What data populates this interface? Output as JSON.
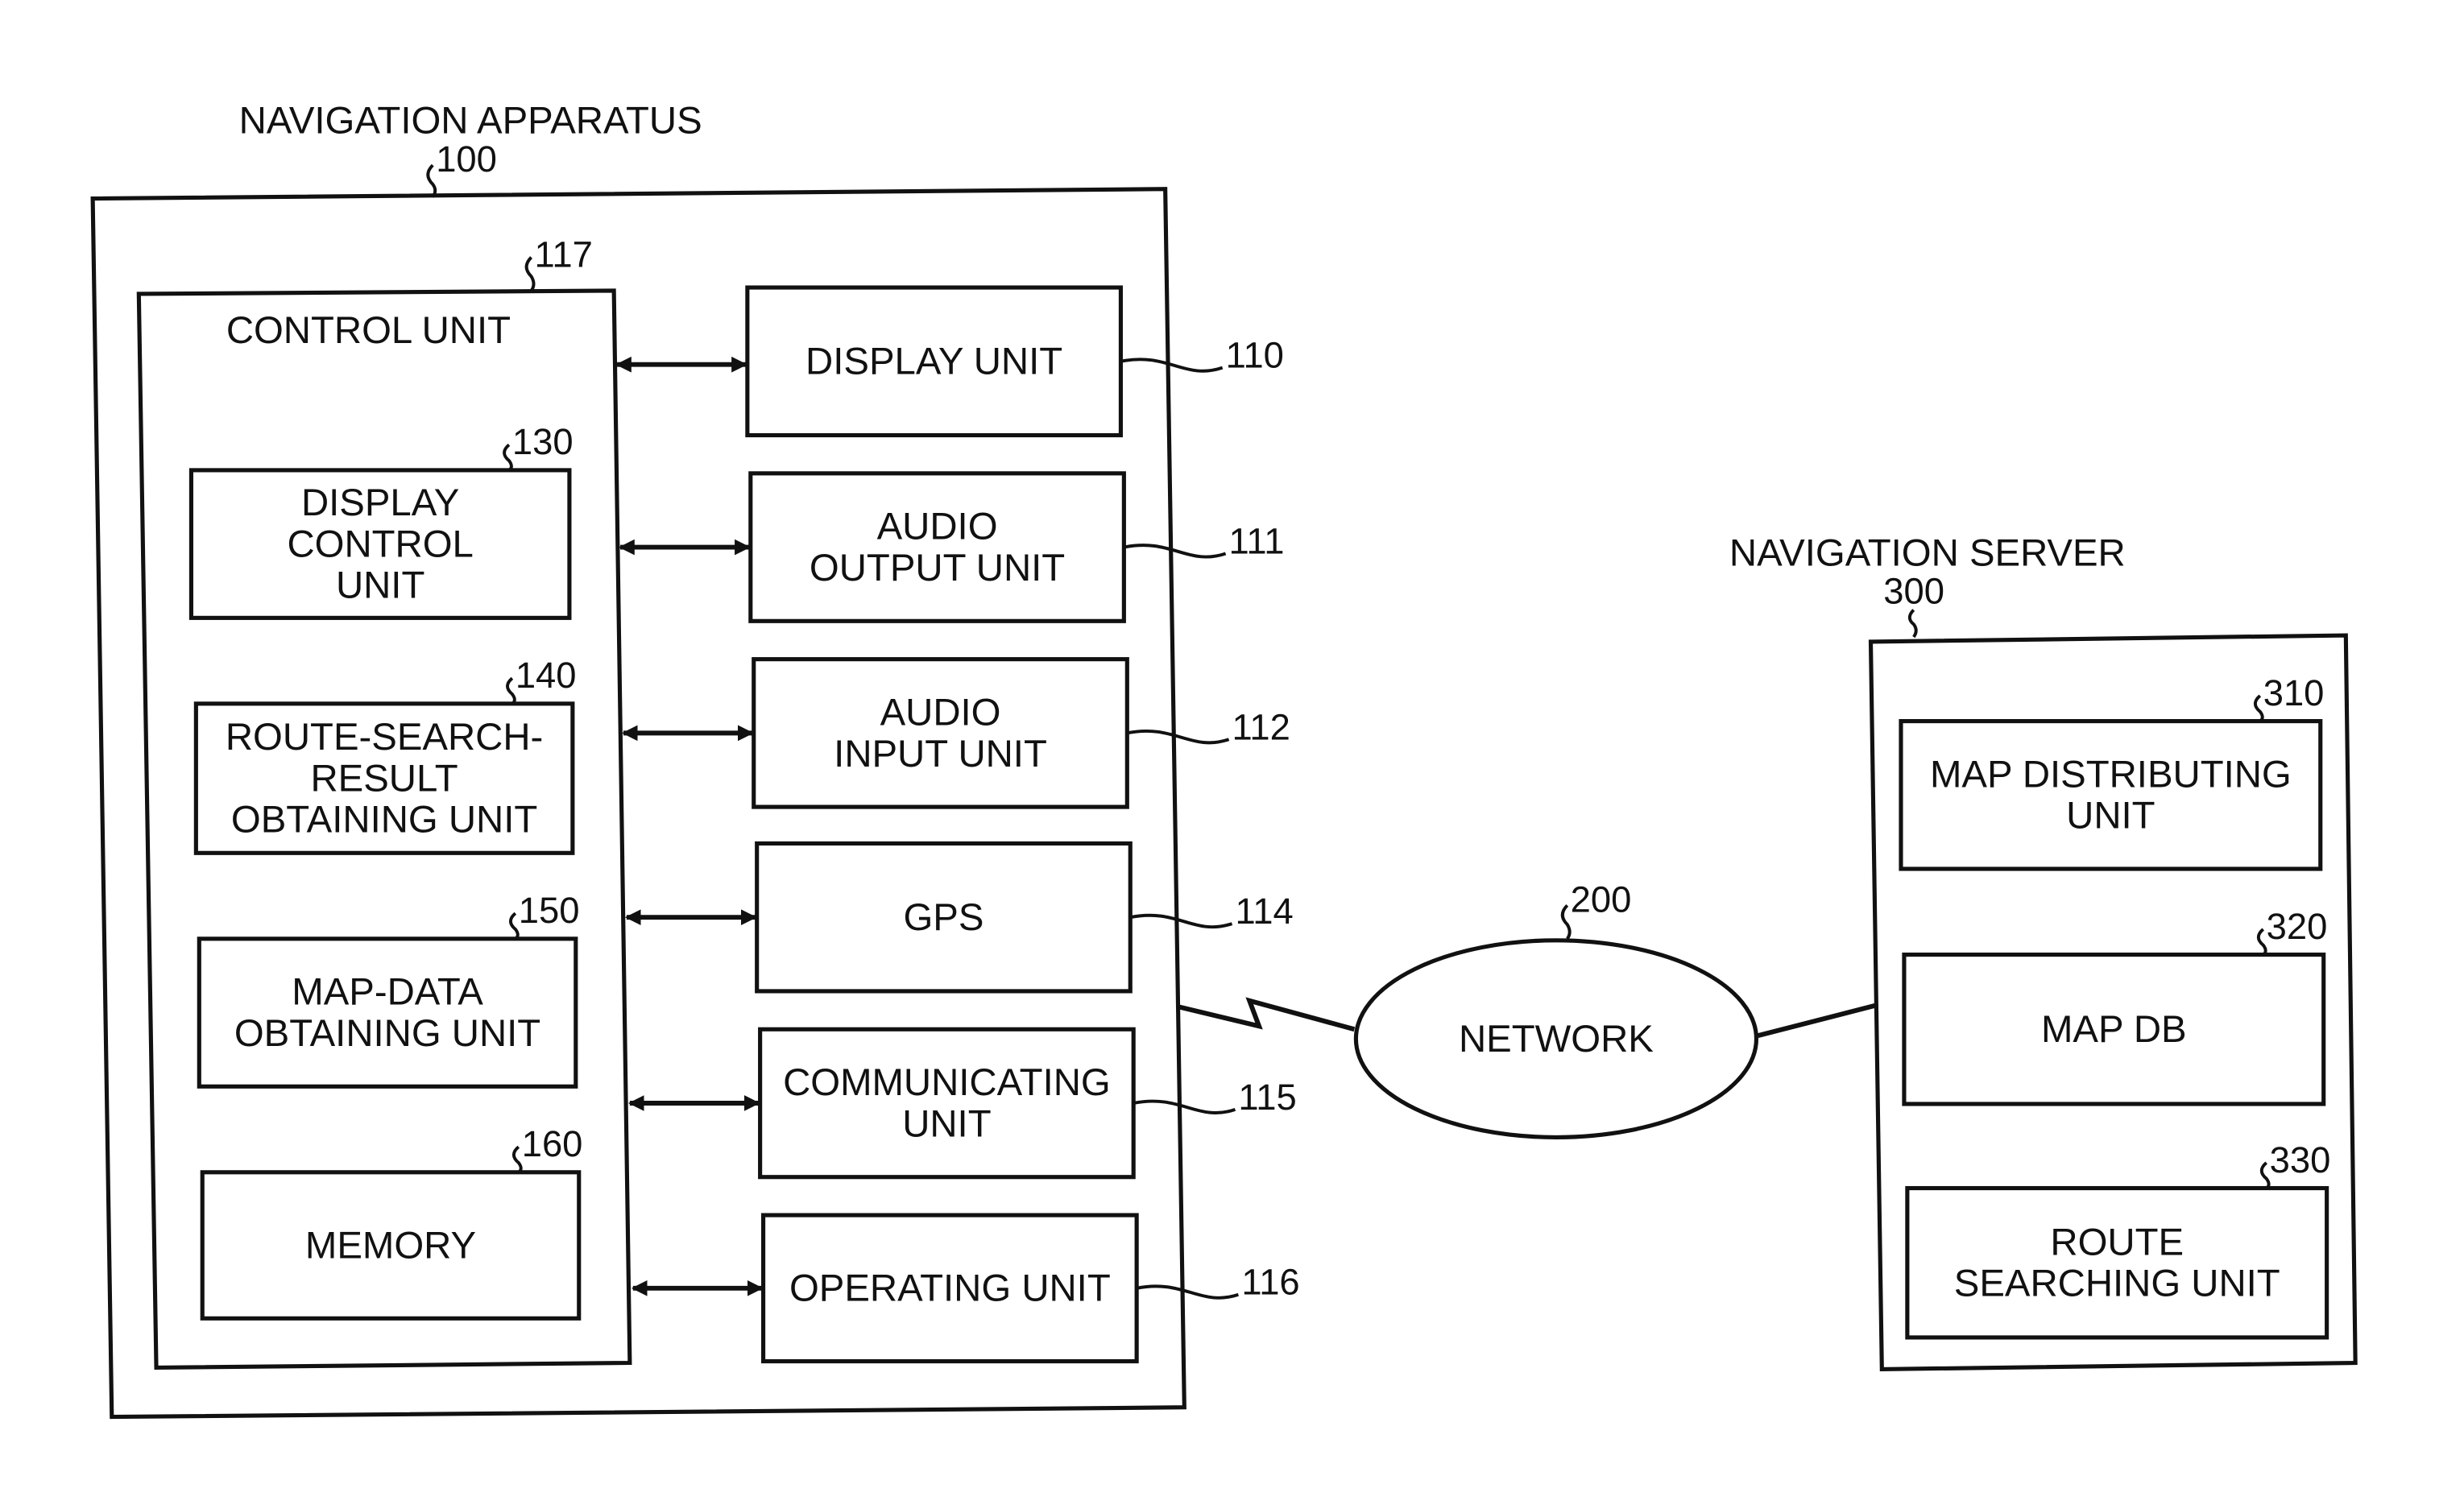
{
  "diagram": {
    "apparatus": {
      "title": "NAVIGATION APPARATUS",
      "ref": "100"
    },
    "control_unit": {
      "title": "CONTROL UNIT",
      "ref": "117"
    },
    "inner_units": [
      {
        "lines": [
          "DISPLAY",
          "CONTROL",
          "UNIT"
        ],
        "ref": "130"
      },
      {
        "lines": [
          "ROUTE-SEARCH-",
          "RESULT",
          "OBTAINING UNIT"
        ],
        "ref": "140"
      },
      {
        "lines": [
          "MAP-DATA",
          "OBTAINING UNIT"
        ],
        "ref": "150"
      },
      {
        "lines": [
          "MEMORY"
        ],
        "ref": "160"
      }
    ],
    "peripheral_units": [
      {
        "lines": [
          "DISPLAY UNIT"
        ],
        "ref": "110"
      },
      {
        "lines": [
          "AUDIO",
          "OUTPUT UNIT"
        ],
        "ref": "111"
      },
      {
        "lines": [
          "AUDIO",
          "INPUT UNIT"
        ],
        "ref": "112"
      },
      {
        "lines": [
          "GPS"
        ],
        "ref": "114"
      },
      {
        "lines": [
          "COMMUNICATING",
          "UNIT"
        ],
        "ref": "115"
      },
      {
        "lines": [
          "OPERATING UNIT"
        ],
        "ref": "116"
      }
    ],
    "network": {
      "title": "NETWORK",
      "ref": "200"
    },
    "server": {
      "title": "NAVIGATION SERVER",
      "ref": "300"
    },
    "server_units": [
      {
        "lines": [
          "MAP DISTRIBUTING",
          "UNIT"
        ],
        "ref": "310"
      },
      {
        "lines": [
          "MAP DB"
        ],
        "ref": "320"
      },
      {
        "lines": [
          "ROUTE",
          "SEARCHING UNIT"
        ],
        "ref": "330"
      }
    ]
  }
}
